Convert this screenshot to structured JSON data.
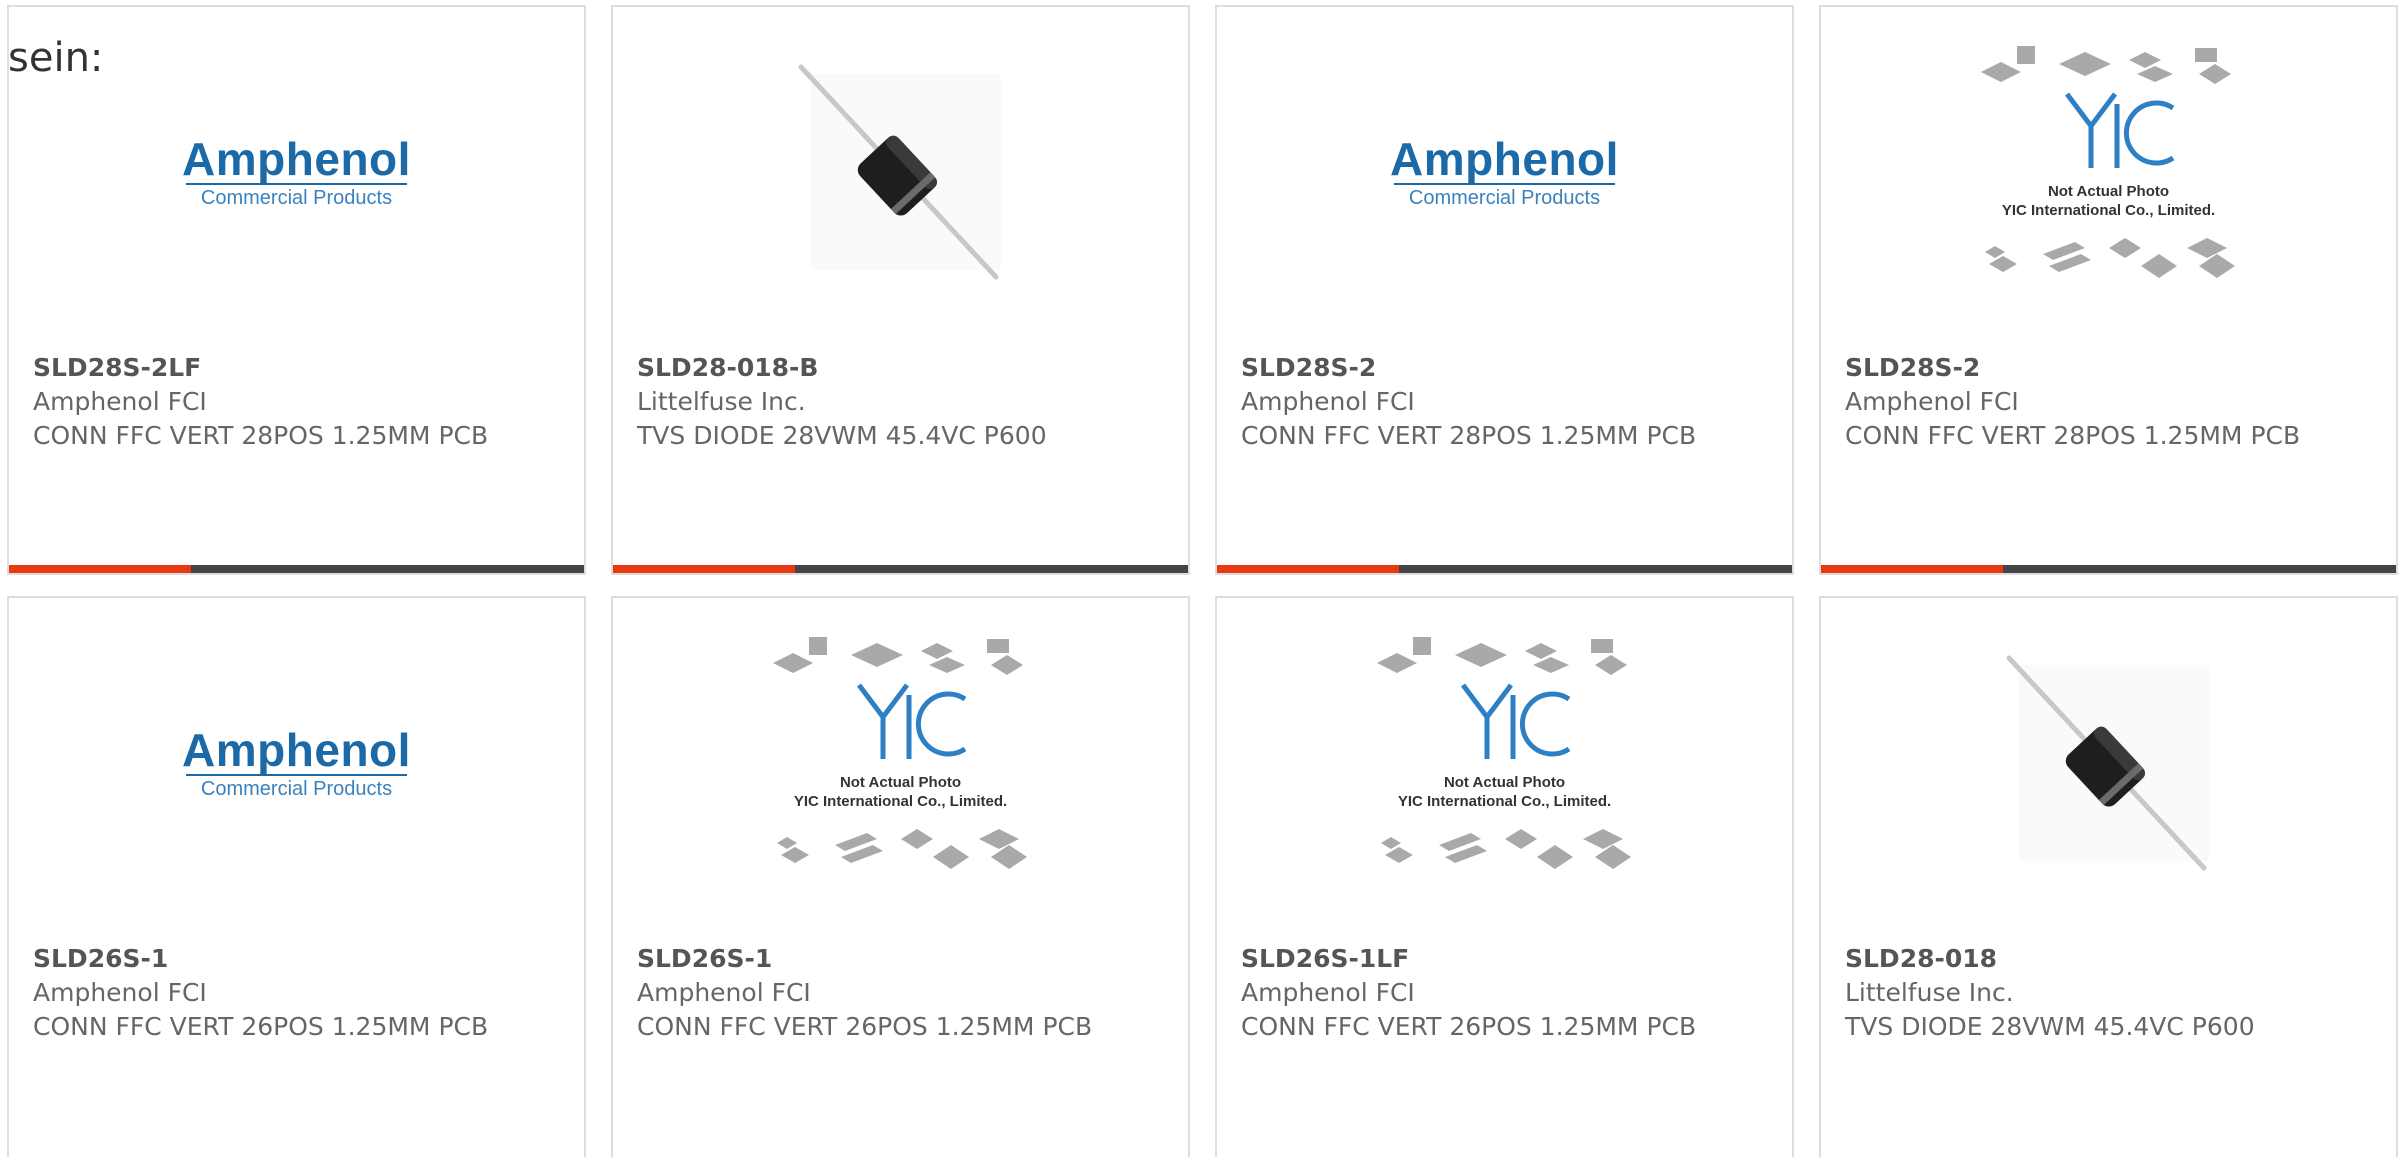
{
  "intro_text": "sein:",
  "colors": {
    "accent": "#e63a12",
    "bar": "#444444",
    "amphenol_blue": "#1b69a6",
    "yic_blue": "#2f7fc4"
  },
  "products": [
    {
      "part": "SLD28S-2LF",
      "manufacturer": "Amphenol FCI",
      "description": "CONN FFC VERT 28POS 1.25MM PCB",
      "image": "amphenol-logo"
    },
    {
      "part": "SLD28-018-B",
      "manufacturer": "Littelfuse Inc.",
      "description": "TVS DIODE 28VWM 45.4VC P600",
      "image": "diode-photo"
    },
    {
      "part": "SLD28S-2",
      "manufacturer": "Amphenol FCI",
      "description": "CONN FFC VERT 28POS 1.25MM PCB",
      "image": "amphenol-logo"
    },
    {
      "part": "SLD28S-2",
      "manufacturer": "Amphenol FCI",
      "description": "CONN FFC VERT 28POS 1.25MM PCB",
      "image": "yic-placeholder"
    },
    {
      "part": "SLD26S-1",
      "manufacturer": "Amphenol FCI",
      "description": "CONN FFC VERT 26POS 1.25MM PCB",
      "image": "amphenol-logo"
    },
    {
      "part": "SLD26S-1",
      "manufacturer": "Amphenol FCI",
      "description": "CONN FFC VERT 26POS 1.25MM PCB",
      "image": "yic-placeholder"
    },
    {
      "part": "SLD26S-1LF",
      "manufacturer": "Amphenol FCI",
      "description": "CONN FFC VERT 26POS 1.25MM PCB",
      "image": "yic-placeholder"
    },
    {
      "part": "SLD28-018",
      "manufacturer": "Littelfuse Inc.",
      "description": "TVS DIODE 28VWM 45.4VC P600",
      "image": "diode-photo"
    }
  ],
  "logos": {
    "amphenol": {
      "name": "Amphenol",
      "subtitle": "Commercial Products"
    },
    "yic": {
      "line1": "Not Actual Photo",
      "line2": "YIC International Co., Limited."
    }
  }
}
